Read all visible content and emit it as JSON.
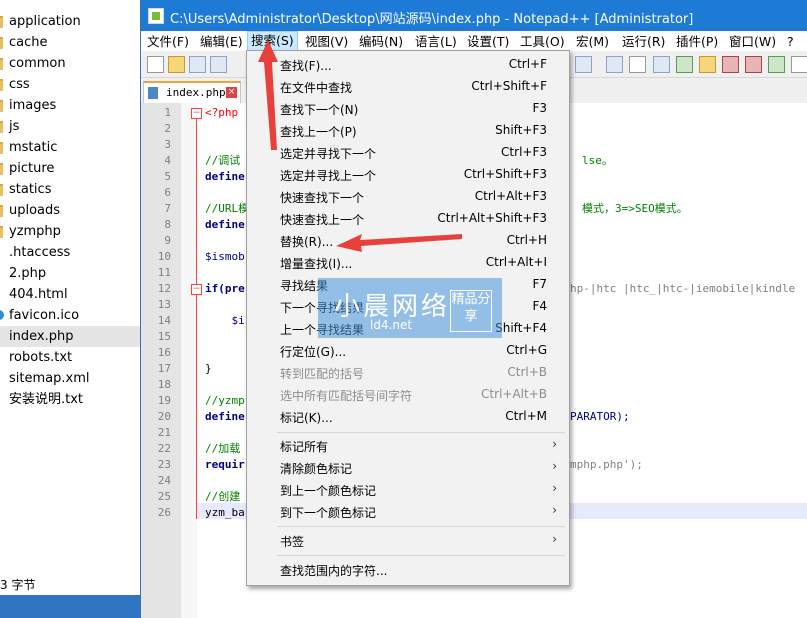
{
  "explorer": {
    "items": [
      {
        "label": "application",
        "type": "folder"
      },
      {
        "label": "cache",
        "type": "folder"
      },
      {
        "label": "common",
        "type": "folder"
      },
      {
        "label": "css",
        "type": "folder"
      },
      {
        "label": "images",
        "type": "folder"
      },
      {
        "label": "js",
        "type": "folder"
      },
      {
        "label": "mstatic",
        "type": "folder"
      },
      {
        "label": "picture",
        "type": "folder"
      },
      {
        "label": "statics",
        "type": "folder"
      },
      {
        "label": "uploads",
        "type": "folder"
      },
      {
        "label": "yzmphp",
        "type": "folder"
      },
      {
        "label": ".htaccess",
        "type": "file"
      },
      {
        "label": "2.php",
        "type": "file"
      },
      {
        "label": "404.html",
        "type": "file"
      },
      {
        "label": "favicon.ico",
        "type": "icon"
      },
      {
        "label": "index.php",
        "type": "file",
        "selected": true
      },
      {
        "label": "robots.txt",
        "type": "file"
      },
      {
        "label": "sitemap.xml",
        "type": "file"
      },
      {
        "label": "安装说明.txt",
        "type": "file"
      }
    ],
    "status": "3 字节"
  },
  "window": {
    "title": "C:\\Users\\Administrator\\Desktop\\网站源码\\index.php - Notepad++ [Administrator]"
  },
  "menubar": {
    "items": [
      "文件(F)",
      "编辑(E)",
      "搜索(S)",
      "视图(V)",
      "编码(N)",
      "语言(L)",
      "设置(T)",
      "工具(O)",
      "宏(M)",
      "运行(R)",
      "插件(P)",
      "窗口(W)",
      "?"
    ],
    "active": "搜索(S)"
  },
  "tab": {
    "label": "index.php",
    "close_icon": "×"
  },
  "editor": {
    "line_numbers": [
      "1",
      "2",
      "3",
      "4",
      "5",
      "6",
      "7",
      "8",
      "9",
      "10",
      "11",
      "12",
      "13",
      "14",
      "15",
      "16",
      "17",
      "18",
      "19",
      "20",
      "21",
      "22",
      "23",
      "24",
      "25",
      "26"
    ],
    "lines": {
      "l1": "<?php",
      "l4": "//调试",
      "l5": "define",
      "l4r": "lse。",
      "l7": "//URL模",
      "l7r": "模式，3=>SEO模式。",
      "l8": "define",
      "l10": "$ismob",
      "l12": "if(pre",
      "l12r": "hp-|htc |htc_|htc-|iemobile|kindle",
      "l14": "    $i",
      "l17": "}",
      "l19": "//yzmp",
      "l20": "define",
      "l20r": "PARATOR);",
      "l22": "//加载",
      "l23": "requir",
      "l23r": "mphp.php');",
      "l25": "//创建",
      "l26": "yzm_ba"
    }
  },
  "search_menu": {
    "items": [
      {
        "label": "查找(F)...",
        "shortcut": "Ctrl+F"
      },
      {
        "label": "在文件中查找",
        "shortcut": "Ctrl+Shift+F"
      },
      {
        "label": "查找下一个(N)",
        "shortcut": "F3"
      },
      {
        "label": "查找上一个(P)",
        "shortcut": "Shift+F3"
      },
      {
        "label": "选定并寻找下一个",
        "shortcut": "Ctrl+F3"
      },
      {
        "label": "选定并寻找上一个",
        "shortcut": "Ctrl+Shift+F3"
      },
      {
        "label": "快速查找下一个",
        "shortcut": "Ctrl+Alt+F3"
      },
      {
        "label": "快速查找上一个",
        "shortcut": "Ctrl+Alt+Shift+F3"
      },
      {
        "label": "替换(R)...",
        "shortcut": "Ctrl+H"
      },
      {
        "label": "增量查找(I)...",
        "shortcut": "Ctrl+Alt+I"
      },
      {
        "label": "寻找结果",
        "shortcut": "F7"
      },
      {
        "label": "下一个寻找结果",
        "shortcut": "F4"
      },
      {
        "label": "上一个寻找结果",
        "shortcut": "Shift+F4"
      },
      {
        "label": "行定位(G)...",
        "shortcut": "Ctrl+G"
      },
      {
        "label": "转到匹配的括号",
        "shortcut": "Ctrl+B",
        "disabled": true
      },
      {
        "label": "选中所有匹配括号间字符",
        "shortcut": "Ctrl+Alt+B",
        "disabled": true
      },
      {
        "label": "标记(K)...",
        "shortcut": "Ctrl+M"
      },
      {
        "label": "标记所有",
        "submenu": true
      },
      {
        "label": "清除颜色标记",
        "submenu": true
      },
      {
        "label": "到上一个颜色标记",
        "submenu": true
      },
      {
        "label": "到下一个颜色标记",
        "submenu": true
      },
      {
        "label": "书签",
        "submenu": true
      },
      {
        "label": "查找范围内的字符..."
      }
    ],
    "submenu_arrow": "›"
  },
  "watermark": {
    "main": "小晨网络",
    "sub": "ld4.net",
    "badge": "精品分享"
  },
  "colors": {
    "titlebar": "#1d7ad5",
    "menu_active": "#cce8ff",
    "annotation": "#e8413b"
  }
}
